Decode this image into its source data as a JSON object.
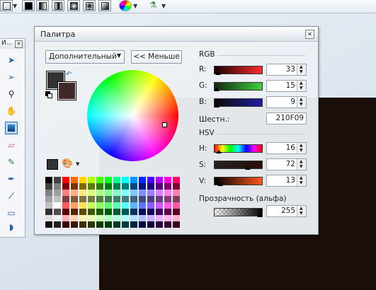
{
  "palette": {
    "title": "Палитра",
    "close": "✕",
    "mode_dropdown": "Дополнительный",
    "less_button": "<< Меньше",
    "rgb_header": "RGB",
    "hsv_header": "HSV",
    "r_label": "R:",
    "g_label": "G:",
    "b_label": "B:",
    "hex_label": "Шестн.:",
    "h_label": "H:",
    "s_label": "S:",
    "v_label": "V:",
    "alpha_label": "Прозрачность (альфа)",
    "r_value": "33",
    "g_value": "15",
    "b_value": "9",
    "hex_value": "210F09",
    "h_value": "16",
    "s_value": "72",
    "v_value": "13",
    "alpha_value": "255",
    "primary_color": "#323232",
    "secondary_color": "#402a29"
  },
  "tools": {
    "title": "И...",
    "close": "✕"
  },
  "icons": {
    "swap": "↶",
    "dropdown_arrow": "▼",
    "spin_up": "▲",
    "spin_down": "▼"
  },
  "colors": {
    "canvas_dark": "#1a0e0b",
    "canvas_light": "#dfe6ee"
  }
}
